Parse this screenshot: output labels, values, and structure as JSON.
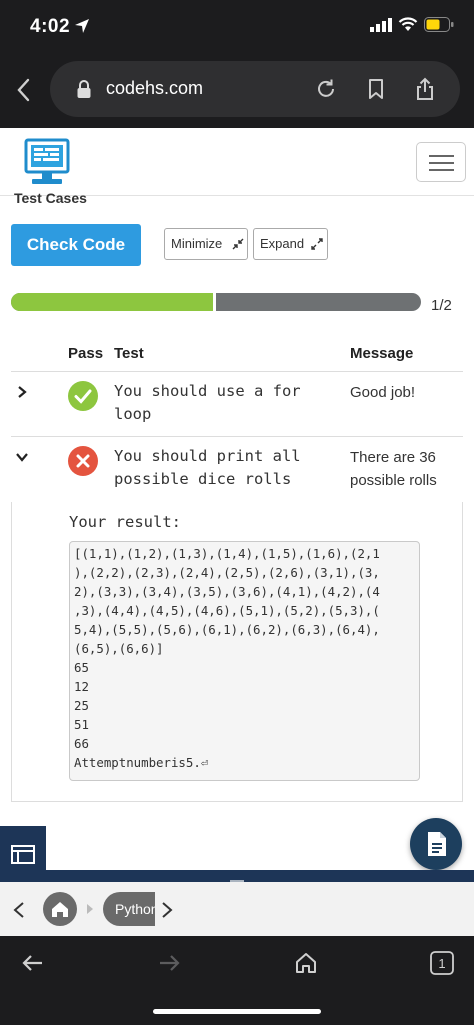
{
  "status_bar": {
    "time": "4:02"
  },
  "browser": {
    "url": "codehs.com"
  },
  "page": {
    "section_title": "Test Cases",
    "check_code_label": "Check Code",
    "minimize_label": "Minimize",
    "expand_label": "Expand",
    "progress": {
      "fraction": 0.5,
      "label": "1/2"
    }
  },
  "table": {
    "headers": {
      "pass": "Pass",
      "test": "Test",
      "message": "Message"
    },
    "rows": [
      {
        "status": "pass",
        "test_line1": "You should use a for",
        "test_line2": "loop",
        "message": "Good job!"
      },
      {
        "status": "fail",
        "test_line1": "You should print all",
        "test_line2": "possible dice rolls",
        "message": "There are 36 possible rolls"
      }
    ]
  },
  "result": {
    "label": "Your result:",
    "lines": [
      "[(1,1),(1,2),(1,3),(1,4),(1,5),(1,6),(2,1",
      "),(2,2),(2,3),(2,4),(2,5),(2,6),(3,1),(3,",
      "2),(3,3),(3,4),(3,5),(3,6),(4,1),(4,2),(4",
      ",3),(4,4),(4,5),(4,6),(5,1),(5,2),(5,3),(",
      "5,4),(5,5),(5,6),(6,1),(6,2),(6,3),(6,4),",
      "(6,5),(6,6)]",
      "65",
      "12",
      "25",
      "51",
      "66",
      "Attemptnumberis5.⏎"
    ]
  },
  "breadcrumb": {
    "python_label": "Python"
  },
  "colors": {
    "check_button": "#2e9be0",
    "progress_pass": "#8dc63f",
    "progress_rest": "#6e7173",
    "pass": "#8dc63f",
    "fail": "#e4543f",
    "navy": "#1d3557"
  }
}
